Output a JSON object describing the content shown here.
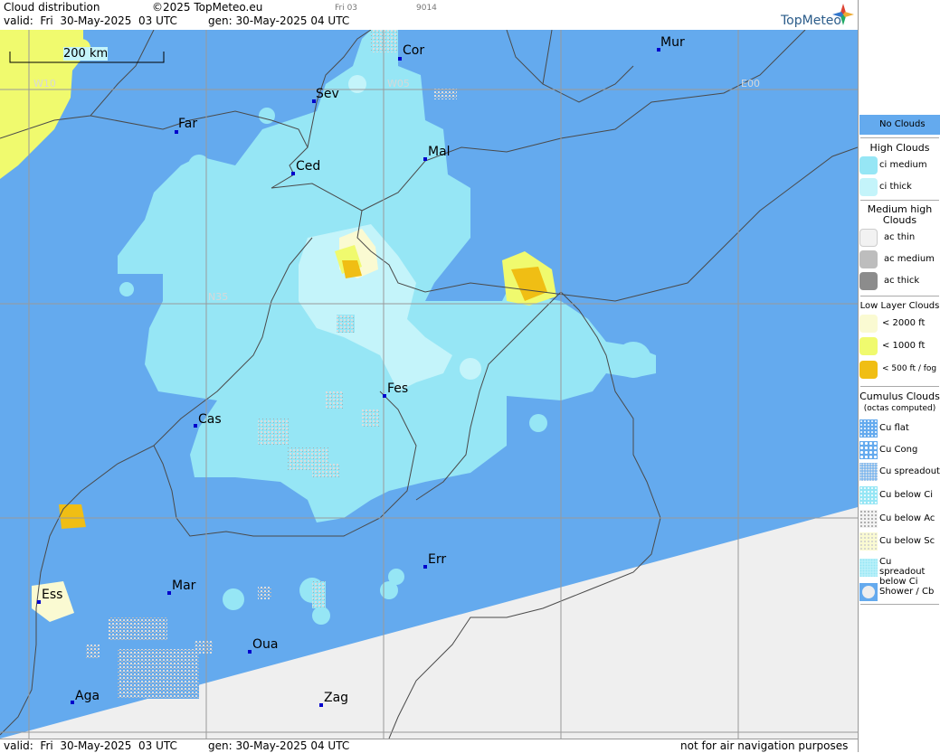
{
  "header": {
    "title": "Cloud distribution",
    "copyright": "©2025 TopMeteo.eu",
    "valid": "valid:  Fri  30-May-2025  03 UTC",
    "gen": "gen: 30-May-2025 04 UTC",
    "small1": "Fri 03",
    "small2": "9014",
    "brand": "TopMeteo"
  },
  "footer": {
    "valid": "valid:  Fri  30-May-2025  03 UTC",
    "gen": "gen: 30-May-2025 04 UTC",
    "disclaimer": "not for air navigation purposes"
  },
  "scale": {
    "label": "200 km"
  },
  "grid_labels": {
    "w10": "W10",
    "w05": "W05",
    "e00": "E00",
    "n35": "N35"
  },
  "cities": [
    {
      "id": "cor",
      "label": "Cor"
    },
    {
      "id": "mur",
      "label": "Mur"
    },
    {
      "id": "sev",
      "label": "Sev"
    },
    {
      "id": "far",
      "label": "Far"
    },
    {
      "id": "mal",
      "label": "Mal"
    },
    {
      "id": "ced",
      "label": "Ced"
    },
    {
      "id": "fes",
      "label": "Fes"
    },
    {
      "id": "cas",
      "label": "Cas"
    },
    {
      "id": "err",
      "label": "Err"
    },
    {
      "id": "ess",
      "label": "Ess"
    },
    {
      "id": "mar",
      "label": "Mar"
    },
    {
      "id": "oua",
      "label": "Oua"
    },
    {
      "id": "aga",
      "label": "Aga"
    },
    {
      "id": "zag",
      "label": "Zag"
    }
  ],
  "legend": {
    "no_clouds": "No Clouds",
    "high_clouds": "High Clouds",
    "ci_medium": "ci medium",
    "ci_thick": "ci thick",
    "medium_high": "Medium high Clouds",
    "ac_thin": "ac thin",
    "ac_medium": "ac medium",
    "ac_thick": "ac thick",
    "low_layer": "Low Layer Clouds",
    "lt2000": "< 2000 ft",
    "lt1000": "< 1000 ft",
    "lt500": "< 500 ft / fog",
    "cumulus": "Cumulus Clouds",
    "cumulus_sub": "(octas computed)",
    "cu_flat": "Cu flat",
    "cu_cong": "Cu Cong",
    "cu_spreadout": "Cu spreadout",
    "cu_below_ci": "Cu below Ci",
    "cu_below_ac": "Cu below Ac",
    "cu_below_sc": "Cu below Sc",
    "cu_spreadout_ci": "Cu spreadout below Ci",
    "shower": "Shower / Cb"
  },
  "colors": {
    "no_clouds": "#64aaee",
    "ci_medium": "#96e6f5",
    "ci_thick": "#c4f4fa",
    "ac_thin": "#f2f2f2",
    "ac_medium": "#bdbdbd",
    "ac_thick": "#8c8c8c",
    "low_2000": "#fafad2",
    "low_1000": "#f0fa6e",
    "low_500": "#f0be14",
    "outside": "#efefef"
  }
}
